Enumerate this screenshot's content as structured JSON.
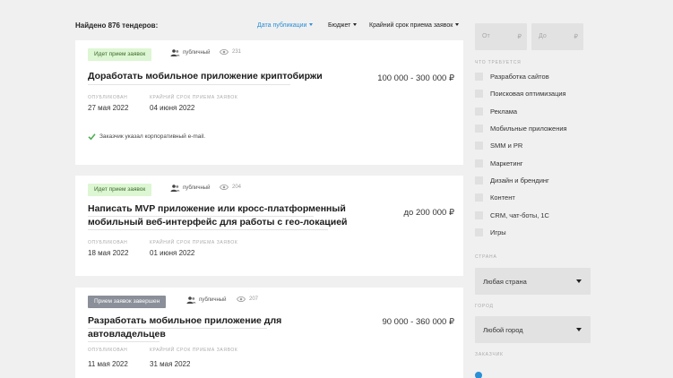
{
  "header": {
    "found_text": "Найдено 876 тендеров:",
    "sort_options": [
      {
        "label": "Дата публикации",
        "active": true
      },
      {
        "label": "Бюджет",
        "active": false
      },
      {
        "label": "Крайний срок приема заявок",
        "active": false
      }
    ]
  },
  "labels": {
    "published": "ОПУБЛИКОВАН",
    "deadline": "КРАЙНИЙ СРОК ПРИЕМА ЗАЯВОК"
  },
  "tenders": [
    {
      "status": "Идет прием заявок",
      "status_type": "open",
      "visibility": "публичный",
      "views": "231",
      "title_lines": [
        "Доработать мобильное приложение криптобиржи"
      ],
      "price": "100 000 - 300 000 ₽",
      "published": "27 мая 2022",
      "deadline": "04 июня 2022",
      "note": "Заказчик указал корпоративный e-mail."
    },
    {
      "status": "Идет прием заявок",
      "status_type": "open",
      "visibility": "публичный",
      "views": "204",
      "title_lines": [
        "Написать MVP приложение или кросс-платформенный",
        "мобильный веб-интерфейс для работы с гео-локацией"
      ],
      "price": "до 200 000 ₽",
      "published": "18 мая 2022",
      "deadline": "01 июня 2022"
    },
    {
      "status": "Прием заявок завершен",
      "status_type": "closed",
      "visibility": "публичный",
      "views": "207",
      "title_lines": [
        "Разработать мобильное приложение для",
        "автовладельцев"
      ],
      "price": "90 000 - 360 000 ₽",
      "published": "11 мая 2022",
      "deadline": "31 мая 2022"
    }
  ],
  "sidebar": {
    "budget_from": {
      "placeholder": "От",
      "currency": "₽"
    },
    "budget_to": {
      "placeholder": "До",
      "currency": "₽"
    },
    "interest_label": "ЧТО ТРЕБУЕТСЯ",
    "categories": [
      "Разработка сайтов",
      "Поисковая оптимизация",
      "Реклама",
      "Мобильные приложения",
      "SMM и PR",
      "Маркетинг",
      "Дизайн и брендинг",
      "Контент",
      "CRM, чат-боты, 1С",
      "Игры"
    ],
    "country_label": "СТРАНА",
    "country_value": "Любая страна",
    "city_label": "ГОРОД",
    "city_value": "Любой город",
    "customer_label": "ЗАКАЗЧИК"
  },
  "colors": {
    "accent": "#2b8fd6",
    "open_badge_bg": "#ddf6d3",
    "closed_badge_bg": "#8a8f99",
    "check": "#4caf50"
  }
}
